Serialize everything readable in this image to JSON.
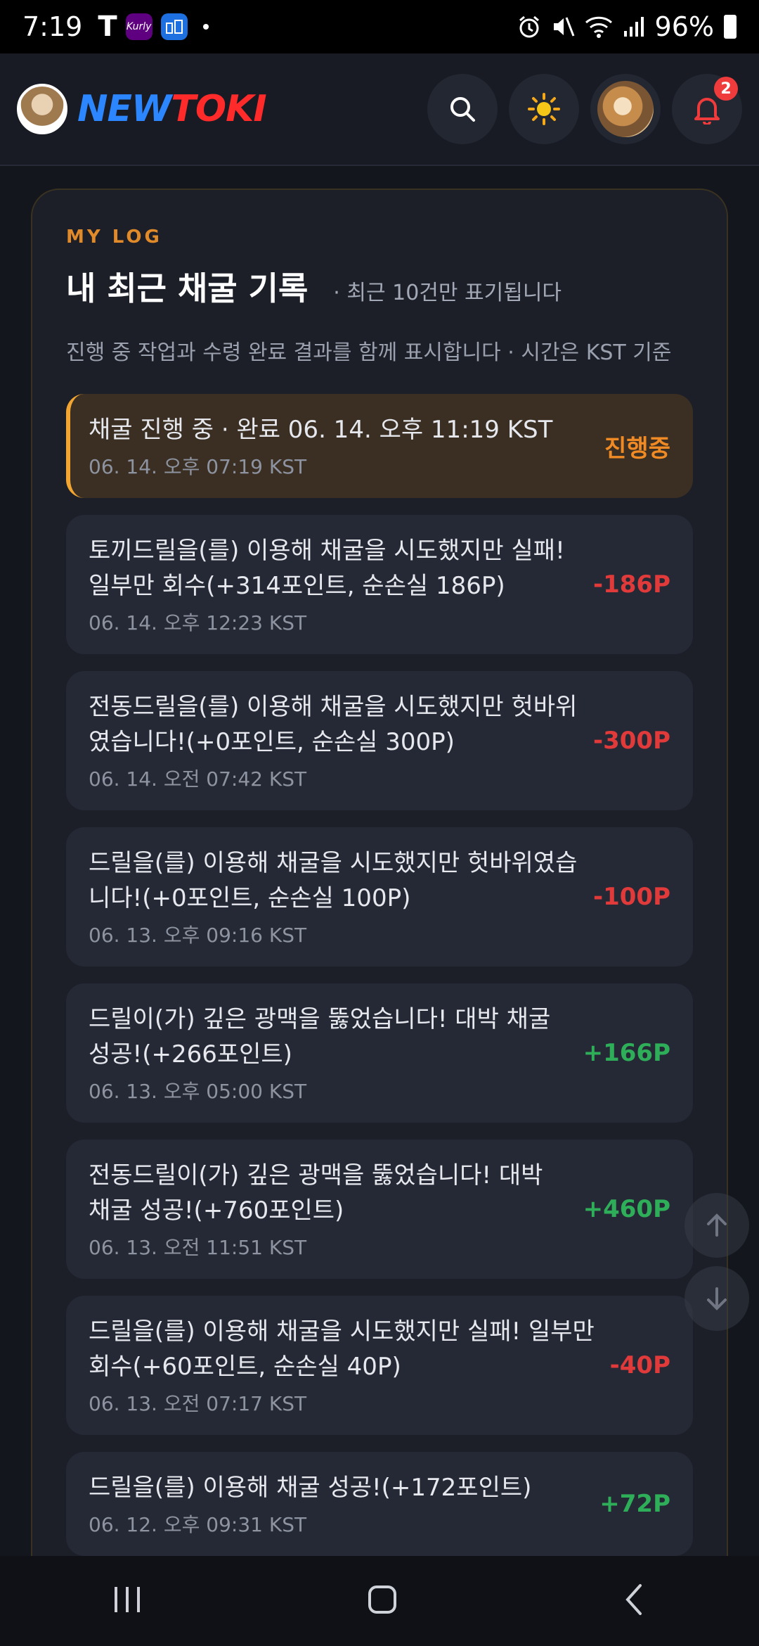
{
  "status_bar": {
    "time": "7:19",
    "app_icons": [
      "T",
      "Kurly",
      "apt"
    ],
    "battery": "96%"
  },
  "header": {
    "logo_new": "NEW",
    "logo_toki": "TOKI",
    "notification_count": "2",
    "icons": [
      "search-icon",
      "sun-icon",
      "user-avatar",
      "bell-icon"
    ]
  },
  "card": {
    "kicker": "MY LOG",
    "title": "내 최근 채굴 기록",
    "title_note": "· 최근 10건만 표기됩니다",
    "subtitle": "진행 중 작업과 수령 완료 결과를 함께 표시합니다 · 시간은 KST 기준"
  },
  "entries": [
    {
      "msg": "채굴 진행 중 · 완료 06. 14. 오후 11:19 KST",
      "when": "06. 14. 오후 07:19 KST",
      "amount": "진행중",
      "state": "active"
    },
    {
      "msg": "토끼드릴을(를) 이용해 채굴을 시도했지만 실패! 일부만 회수(+314포인트, 순손실 186P)",
      "when": "06. 14. 오후 12:23 KST",
      "amount": "-186P",
      "state": "neg"
    },
    {
      "msg": "전동드릴을(를) 이용해 채굴을 시도했지만 헛바위였습니다!(+0포인트, 순손실 300P)",
      "when": "06. 14. 오전 07:42 KST",
      "amount": "-300P",
      "state": "neg"
    },
    {
      "msg": "드릴을(를) 이용해 채굴을 시도했지만 헛바위였습니다!(+0포인트, 순손실 100P)",
      "when": "06. 13. 오후 09:16 KST",
      "amount": "-100P",
      "state": "neg"
    },
    {
      "msg": "드릴이(가) 깊은 광맥을 뚫었습니다! 대박 채굴 성공!(+266포인트)",
      "when": "06. 13. 오후 05:00 KST",
      "amount": "+166P",
      "state": "pos"
    },
    {
      "msg": "전동드릴이(가) 깊은 광맥을 뚫었습니다! 대박 채굴 성공!(+760포인트)",
      "when": "06. 13. 오전 11:51 KST",
      "amount": "+460P",
      "state": "pos"
    },
    {
      "msg": "드릴을(를) 이용해 채굴을 시도했지만 실패! 일부만 회수(+60포인트, 순손실 40P)",
      "when": "06. 13. 오전 07:17 KST",
      "amount": "-40P",
      "state": "neg"
    },
    {
      "msg": "드릴을(를) 이용해 채굴 성공!(+172포인트)",
      "when": "06. 12. 오후 09:31 KST",
      "amount": "+72P",
      "state": "pos"
    }
  ],
  "colors": {
    "accent": "#f2a531",
    "negative": "#e03a3a",
    "positive": "#2fae5a",
    "background": "#13161d"
  }
}
